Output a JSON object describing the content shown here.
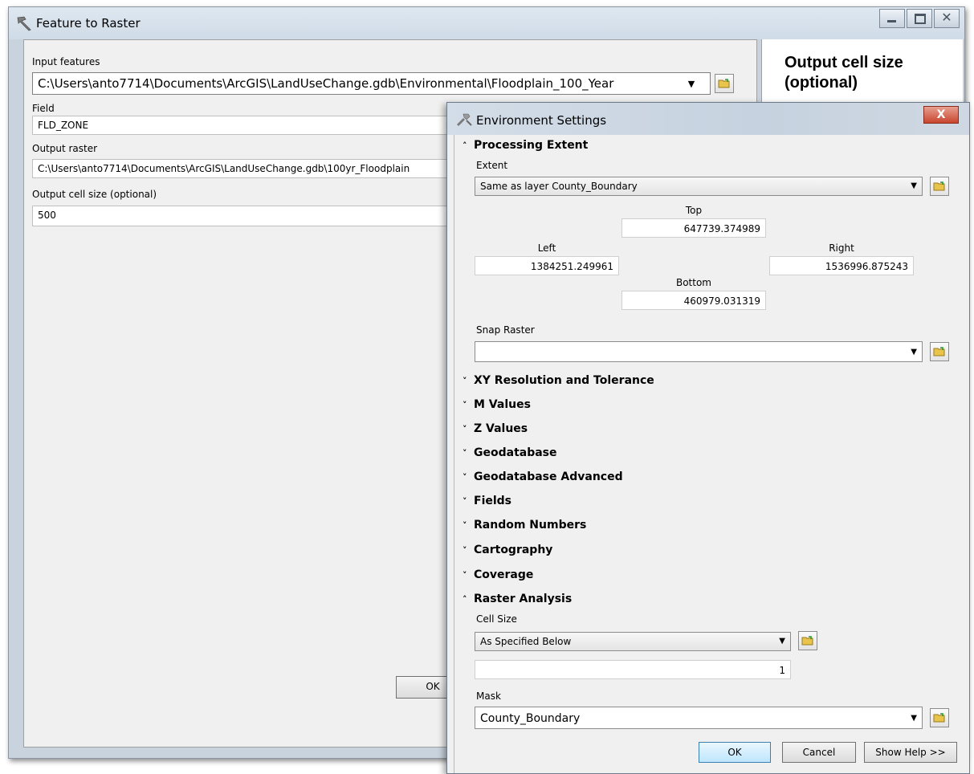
{
  "main_window": {
    "title": "Feature to Raster",
    "input_features_label": "Input features",
    "input_features_value": "C:\\Users\\anto7714\\Documents\\ArcGIS\\LandUseChange.gdb\\Environmental\\Floodplain_100_Year",
    "field_label": "Field",
    "field_value": "FLD_ZONE",
    "output_raster_label": "Output raster",
    "output_raster_value": "C:\\Users\\anto7714\\Documents\\ArcGIS\\LandUseChange.gdb\\100yr_Floodplain",
    "cell_size_label": "Output cell size (optional)",
    "cell_size_value": "500",
    "ok_label": "OK",
    "help_title": "Output cell size (optional)"
  },
  "env_dialog": {
    "title": "Environment Settings",
    "close_glyph": "X",
    "processing_extent": {
      "label": "Processing Extent",
      "extent_label": "Extent",
      "extent_value": "Same as layer County_Boundary",
      "top_label": "Top",
      "top_value": "647739.374989",
      "left_label": "Left",
      "left_value": "1384251.249961",
      "right_label": "Right",
      "right_value": "1536996.875243",
      "bottom_label": "Bottom",
      "bottom_value": "460979.031319",
      "snap_raster_label": "Snap Raster",
      "snap_raster_value": ""
    },
    "collapsed_sections": [
      "XY Resolution and Tolerance",
      "M Values",
      "Z Values",
      "Geodatabase",
      "Geodatabase Advanced",
      "Fields",
      "Random Numbers",
      "Cartography",
      "Coverage"
    ],
    "raster_analysis": {
      "label": "Raster Analysis",
      "cell_size_label": "Cell Size",
      "cell_size_value": "As Specified Below",
      "cell_size_number": "1",
      "mask_label": "Mask",
      "mask_value": "County_Boundary"
    },
    "buttons": {
      "ok": "OK",
      "cancel": "Cancel",
      "show_help": "Show Help >>"
    }
  },
  "icons": {
    "expanded": "chevron-up-icon",
    "collapsed": "chevron-down-icon",
    "browse": "folder-icon"
  },
  "colors": {
    "title_bar": "#cfdbe7",
    "close_button": "#c8452f",
    "panel_bg": "#f0f0f0"
  }
}
